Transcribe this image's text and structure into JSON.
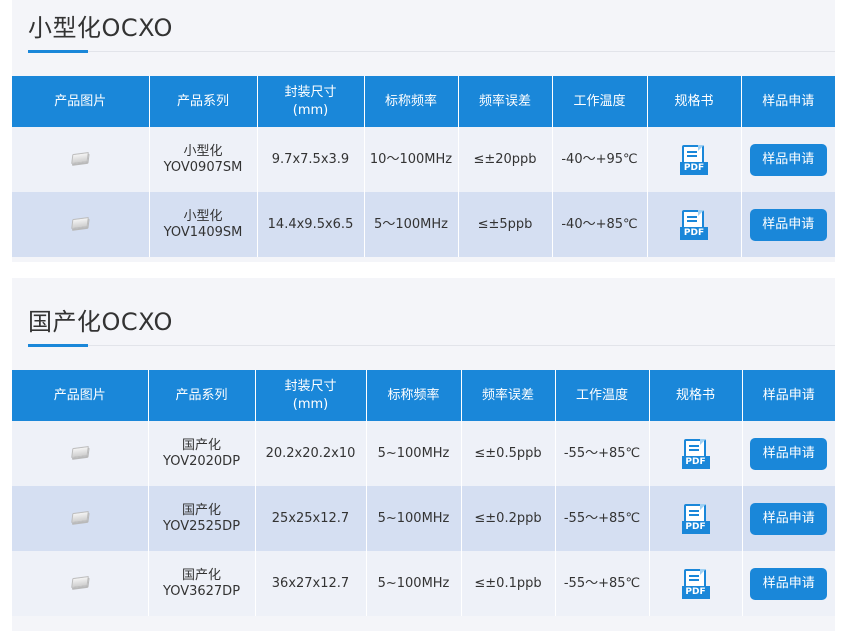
{
  "sections": [
    {
      "title": "小型化OCXO",
      "headers": [
        "产品图片",
        "产品系列",
        "封装尺寸\n(mm)",
        "标称频率",
        "频率误差",
        "工作温度",
        "规格书",
        "样品申请"
      ],
      "rows": [
        {
          "series": "小型化\nYOV0907SM",
          "size": "9.7x7.5x3.9",
          "freq": "10～100MHz",
          "error": "≤±20ppb",
          "temp": "-40～+95℃",
          "pdf": "PDF",
          "button": "样品申请"
        },
        {
          "series": "小型化\nYOV1409SM",
          "size": "14.4x9.5x6.5",
          "freq": "5～100MHz",
          "error": "≤±5ppb",
          "temp": "-40～+85℃",
          "pdf": "PDF",
          "button": "样品申请"
        }
      ]
    },
    {
      "title": "国产化OCXO",
      "headers": [
        "产品图片",
        "产品系列",
        "封装尺寸\n(mm)",
        "标称频率",
        "频率误差",
        "工作温度",
        "规格书",
        "样品申请"
      ],
      "rows": [
        {
          "series": "国产化\nYOV2020DP",
          "size": "20.2x20.2x10",
          "freq": "5~100MHz",
          "error": "≤±0.5ppb",
          "temp": "-55～+85℃",
          "pdf": "PDF",
          "button": "样品申请"
        },
        {
          "series": "国产化\nYOV2525DP",
          "size": "25x25x12.7",
          "freq": "5~100MHz",
          "error": "≤±0.2ppb",
          "temp": "-55～+85℃",
          "pdf": "PDF",
          "button": "样品申请"
        },
        {
          "series": "国产化\nYOV3627DP",
          "size": "36x27x12.7",
          "freq": "5~100MHz",
          "error": "≤±0.1ppb",
          "temp": "-55～+85℃",
          "pdf": "PDF",
          "button": "样品申请"
        }
      ]
    }
  ],
  "colors": {
    "accent": "#1a87d9",
    "row_odd": "#eef1f8",
    "row_even": "#d5dff2"
  },
  "icons": {
    "product_image": "chip-icon",
    "spec_sheet": "pdf-icon"
  }
}
